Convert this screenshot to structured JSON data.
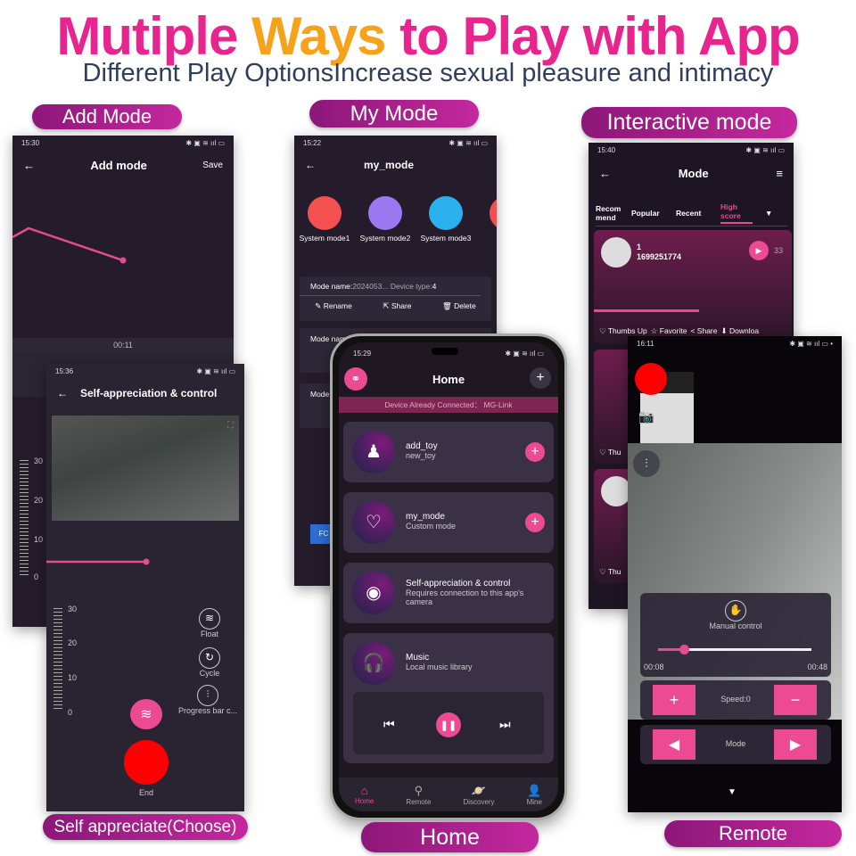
{
  "header": {
    "title_parts": [
      "Mutiple ",
      "Ways",
      " to Play with App"
    ],
    "subtitle": "Different Play OptionsIncrease sexual pleasure and intimacy"
  },
  "labels": {
    "add_mode": "Add Mode",
    "my_mode": "My Mode",
    "interactive": "Interactive mode",
    "self": "Self appreciate(Choose)",
    "home": "Home",
    "remote": "Remote"
  },
  "colors": {
    "accent": "#ec4a93",
    "label_bg": "#a8208c",
    "screen_bg": "#241c2b"
  },
  "add_mode": {
    "time": "15:30",
    "title": "Add mode",
    "save": "Save",
    "timer": "00:11",
    "ruler": [
      "30",
      "20",
      "10",
      "0"
    ]
  },
  "self_app": {
    "time": "15:36",
    "title": "Self-appreciation & control",
    "ruler": [
      "30",
      "20",
      "10",
      "0"
    ],
    "float": "Float",
    "cycle": "Cycle",
    "progress": "Progress bar c...",
    "end": "End"
  },
  "my_mode": {
    "time": "15:22",
    "title": "my_mode",
    "modes": [
      {
        "label": "System mode1",
        "color": "#f4504f"
      },
      {
        "label": "System mode2",
        "color": "#9a78f0"
      },
      {
        "label": "System mode3",
        "color": "#2bb0ee"
      },
      {
        "label": "Syste",
        "color": "#f4504f"
      }
    ],
    "mode_name_label": "Mode name:",
    "mode_name_value": "2024053...",
    "device_type_label": "Device type:",
    "device_type_value": "4",
    "rename": "Rename",
    "share": "Share",
    "delete": "Delete",
    "mode_name_partial": "Mode nam",
    "mode_partial": "Mode",
    "fo": "FC"
  },
  "interactive": {
    "time": "15:40",
    "title": "Mode",
    "tabs": [
      "Recom mend",
      "Popular",
      "Recent",
      "High score"
    ],
    "active_tab": 3,
    "item": {
      "name": "1",
      "id": "1699251774",
      "count": "33",
      "progress": 0.62
    },
    "actions": [
      "Thumbs Up",
      "Favorite",
      "Share",
      "Downloa"
    ],
    "thu": "Thu"
  },
  "home": {
    "time": "15:29",
    "title": "Home",
    "banner": "Device Already Connected： MG-Link",
    "items": [
      {
        "title": "add_toy",
        "sub": "new_toy"
      },
      {
        "title": "my_mode",
        "sub": "Custom mode"
      },
      {
        "title": "Self-appreciation & control",
        "sub": "Requires connection to this app's camera"
      },
      {
        "title": "Music",
        "sub": "Local music library"
      }
    ],
    "nav": [
      "Home",
      "Remote",
      "Discovery",
      "Mine"
    ],
    "active_nav": 0
  },
  "remote": {
    "time": "16:11",
    "manual": "Manual control",
    "start": "00:08",
    "end": "00:48",
    "progress": 0.17,
    "speed": "Speed:0",
    "mode": "Mode"
  }
}
